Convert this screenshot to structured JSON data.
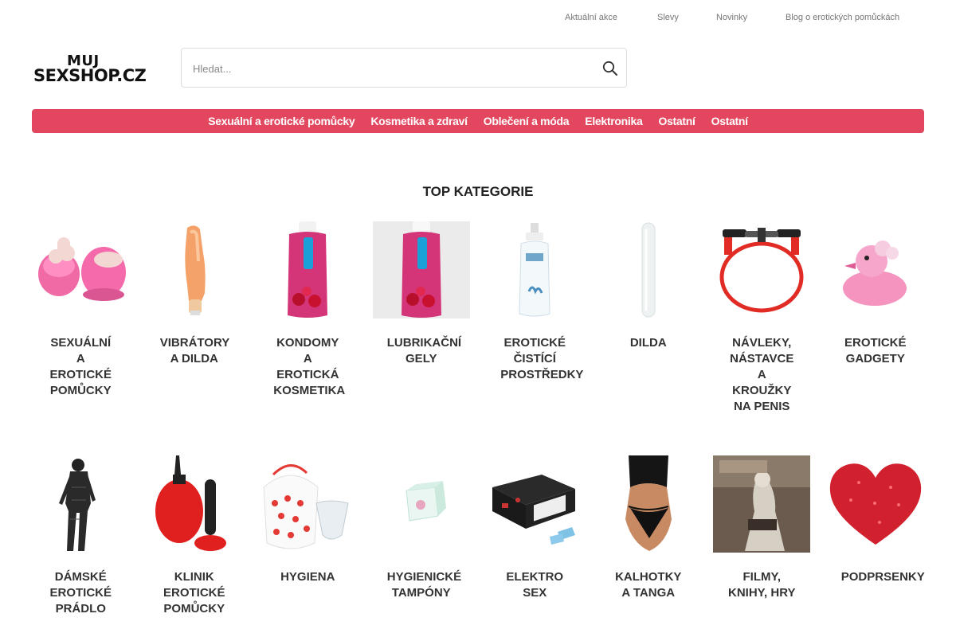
{
  "top_links": [
    "Aktuální akce",
    "Slevy",
    "Novinky",
    "Blog o erotických pomůckách"
  ],
  "logo": {
    "line1": "MUJ",
    "line2": "SEXSHOP.CZ"
  },
  "search": {
    "placeholder": "Hledat...",
    "icon": "search-icon"
  },
  "menu": [
    "Sexuální a erotické pomůcky",
    "Kosmetika a zdraví",
    "Oblečení a móda",
    "Elektronika",
    "Ostatní",
    "Ostatní"
  ],
  "colors": {
    "accent": "#e2475f"
  },
  "top_categories": {
    "title": "TOP KATEGORIE",
    "row1": [
      {
        "label": "Sexuální a erotické pomůcky",
        "image": "pink-penis-slippers"
      },
      {
        "label": "Vibrátory a dilda",
        "image": "flesh-vibrator"
      },
      {
        "label": "Kondomy a erotická kosmetika",
        "image": "durex-cherry-gel"
      },
      {
        "label": "Lubrikační gely",
        "image": "durex-cherry-gel"
      },
      {
        "label": "Erotické čistící prostředky",
        "image": "toy-cleaner-spray"
      },
      {
        "label": "Dilda",
        "image": "clear-dildo"
      },
      {
        "label": "Návleky, nástavce a kroužky na penis",
        "image": "red-penis-ring"
      },
      {
        "label": "Erotické gadgety",
        "image": "pink-rubber-duck"
      }
    ],
    "row2": [
      {
        "label": "Dámské erotické prádlo",
        "image": "lace-bodystocking"
      },
      {
        "label": "Klinik erotické pomůcky",
        "image": "red-anal-douche"
      },
      {
        "label": "Hygiena",
        "image": "menstrual-cup"
      },
      {
        "label": "Hygienické tampóny",
        "image": "soft-tampons"
      },
      {
        "label": "Elektro sex",
        "image": "estim-kit"
      },
      {
        "label": "Kalhotky a tanga",
        "image": "string-thong"
      },
      {
        "label": "Filmy, knihy, hry",
        "image": "royo-calendar"
      },
      {
        "label": "Podprsenky",
        "image": "glitter-heart-pasty"
      }
    ]
  }
}
